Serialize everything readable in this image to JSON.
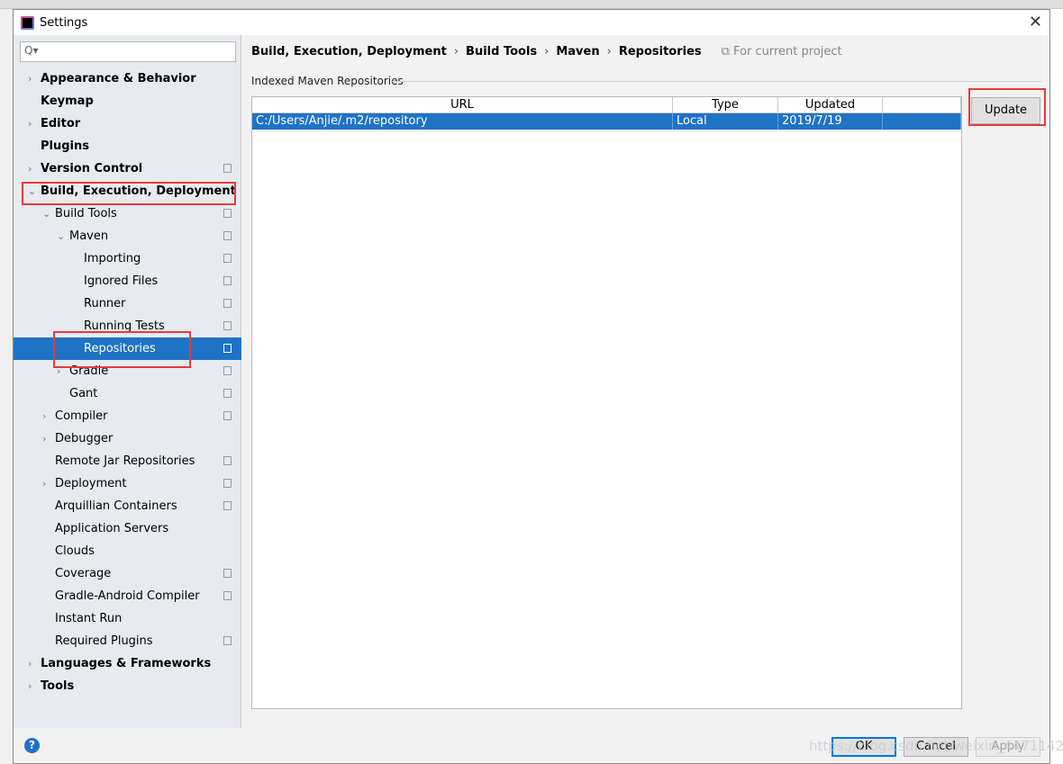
{
  "window": {
    "title": "Settings",
    "close": "✕"
  },
  "search": {
    "placeholder": "Q▾"
  },
  "tree": [
    {
      "label": "Appearance & Behavior",
      "level": 0,
      "arrow": "›",
      "bold": true
    },
    {
      "label": "Keymap",
      "level": 0,
      "arrow": "",
      "bold": true
    },
    {
      "label": "Editor",
      "level": 0,
      "arrow": "›",
      "bold": true
    },
    {
      "label": "Plugins",
      "level": 0,
      "arrow": "",
      "bold": true
    },
    {
      "label": "Version Control",
      "level": 0,
      "arrow": "›",
      "bold": true,
      "copy": true
    },
    {
      "label": "Build, Execution, Deployment",
      "level": 0,
      "arrow": "⌄",
      "bold": true
    },
    {
      "label": "Build Tools",
      "level": 1,
      "arrow": "⌄",
      "copy": true
    },
    {
      "label": "Maven",
      "level": 2,
      "arrow": "⌄",
      "copy": true
    },
    {
      "label": "Importing",
      "level": 3,
      "arrow": "",
      "copy": true
    },
    {
      "label": "Ignored Files",
      "level": 3,
      "arrow": "",
      "copy": true
    },
    {
      "label": "Runner",
      "level": 3,
      "arrow": "",
      "copy": true
    },
    {
      "label": "Running Tests",
      "level": 3,
      "arrow": "",
      "copy": true
    },
    {
      "label": "Repositories",
      "level": 3,
      "arrow": "",
      "copy": true,
      "selected": true
    },
    {
      "label": "Gradle",
      "level": 2,
      "arrow": "›",
      "copy": true
    },
    {
      "label": "Gant",
      "level": 2,
      "arrow": "",
      "copy": true
    },
    {
      "label": "Compiler",
      "level": 1,
      "arrow": "›",
      "copy": true
    },
    {
      "label": "Debugger",
      "level": 1,
      "arrow": "›"
    },
    {
      "label": "Remote Jar Repositories",
      "level": 1,
      "arrow": "",
      "copy": true
    },
    {
      "label": "Deployment",
      "level": 1,
      "arrow": "›",
      "copy": true
    },
    {
      "label": "Arquillian Containers",
      "level": 1,
      "arrow": "",
      "copy": true
    },
    {
      "label": "Application Servers",
      "level": 1,
      "arrow": ""
    },
    {
      "label": "Clouds",
      "level": 1,
      "arrow": ""
    },
    {
      "label": "Coverage",
      "level": 1,
      "arrow": "",
      "copy": true
    },
    {
      "label": "Gradle-Android Compiler",
      "level": 1,
      "arrow": "",
      "copy": true
    },
    {
      "label": "Instant Run",
      "level": 1,
      "arrow": ""
    },
    {
      "label": "Required Plugins",
      "level": 1,
      "arrow": "",
      "copy": true
    },
    {
      "label": "Languages & Frameworks",
      "level": 0,
      "arrow": "›",
      "bold": true
    },
    {
      "label": "Tools",
      "level": 0,
      "arrow": "›",
      "bold": true
    }
  ],
  "breadcrumb": [
    "Build, Execution, Deployment",
    "Build Tools",
    "Maven",
    "Repositories"
  ],
  "breadcrumb_sep": "›",
  "for_project": "⧉ For current project",
  "group_title": "Indexed Maven Repositories",
  "table": {
    "columns": [
      "URL",
      "Type",
      "Updated",
      ""
    ],
    "rows": [
      [
        "C:/Users/Anjie/.m2/repository",
        "Local",
        "2019/7/19",
        ""
      ]
    ]
  },
  "update_label": "Update",
  "footer": {
    "help": "?",
    "ok": "OK",
    "cancel": "Cancel",
    "apply": "Apply"
  },
  "watermark": "https://blog.csdn.net/weixin_44711425",
  "colors": {
    "selection": "#1f73c6",
    "highlight": "#e63b3b"
  }
}
